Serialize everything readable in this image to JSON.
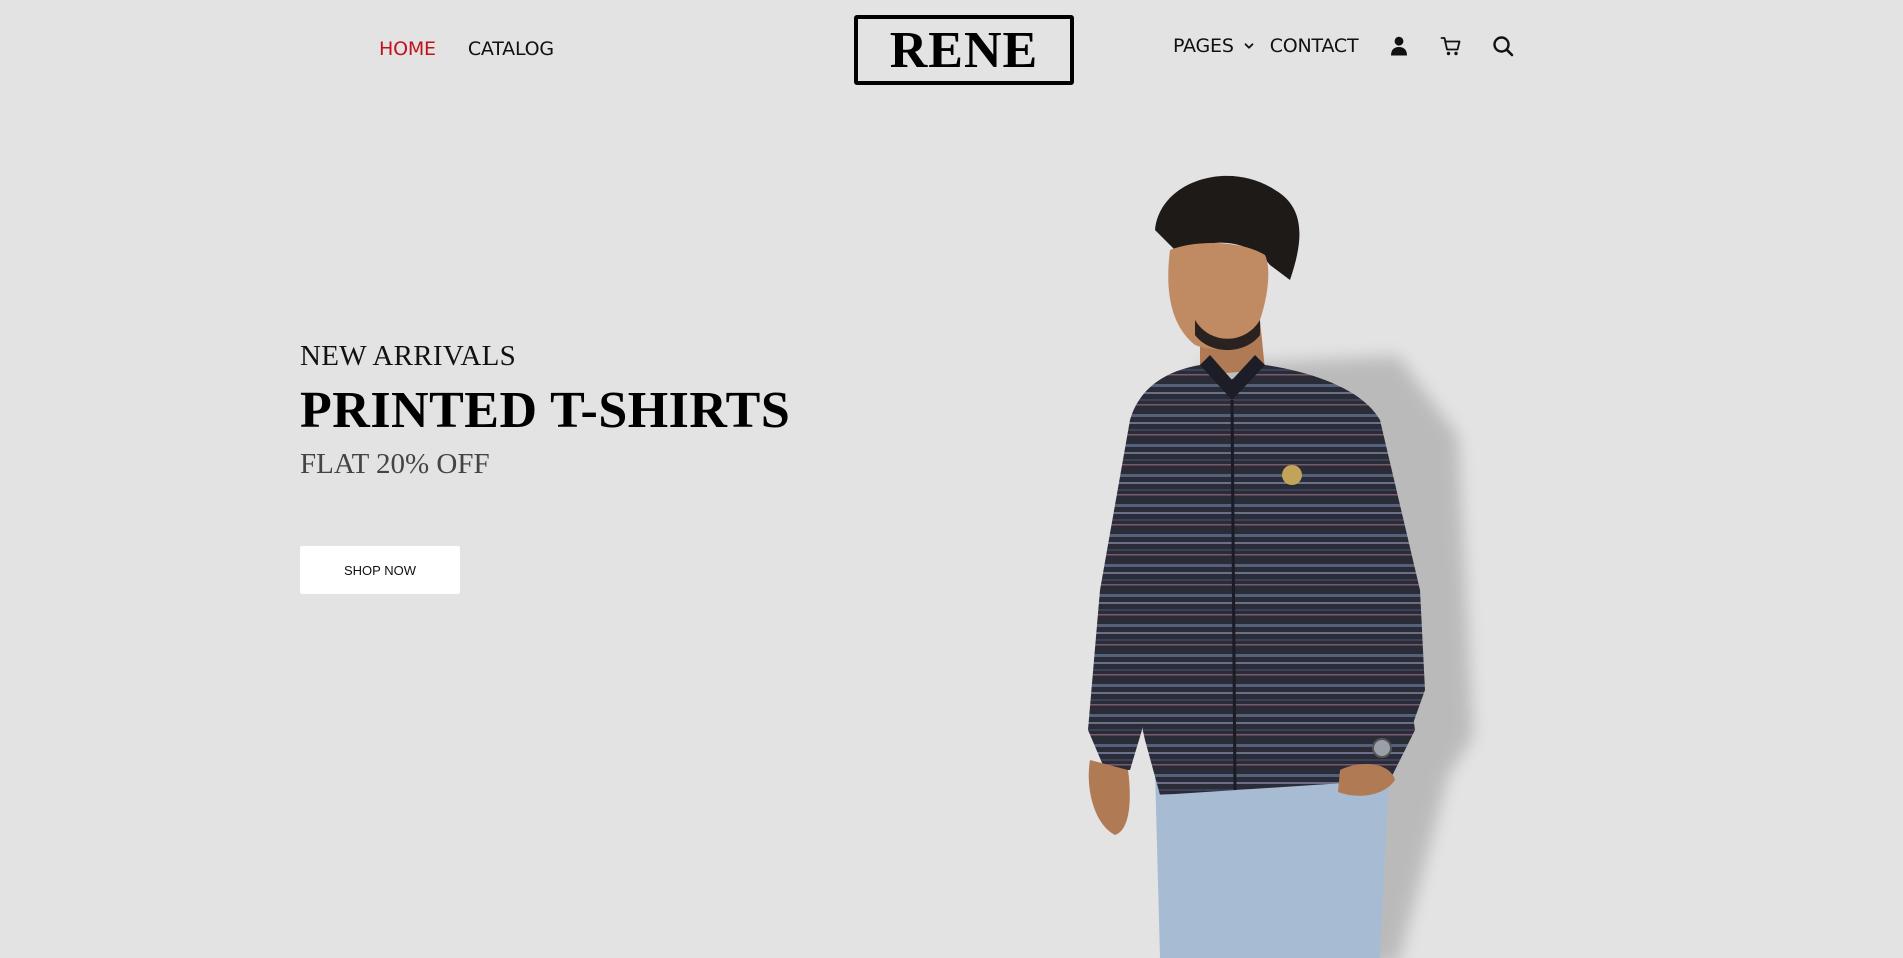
{
  "header": {
    "nav_left": [
      {
        "label": "HOME",
        "active": true
      },
      {
        "label": "CATALOG",
        "active": false
      }
    ],
    "logo": "RENE",
    "nav_right": {
      "pages_label": "PAGES",
      "contact_label": "CONTACT"
    },
    "icons": [
      "user-icon",
      "cart-icon",
      "search-icon",
      "chevron-down-icon"
    ],
    "active_color": "#c0121a"
  },
  "hero": {
    "eyebrow": "NEW ARRIVALS",
    "headline": "PRINTED T-SHIRTS",
    "offer": "FLAT 20% OFF",
    "cta_label": "SHOP NOW",
    "background_color": "#e3e3e3"
  },
  "model": {
    "shirt_color": "#2a2c38",
    "jeans_color": "#a7bcd3"
  }
}
